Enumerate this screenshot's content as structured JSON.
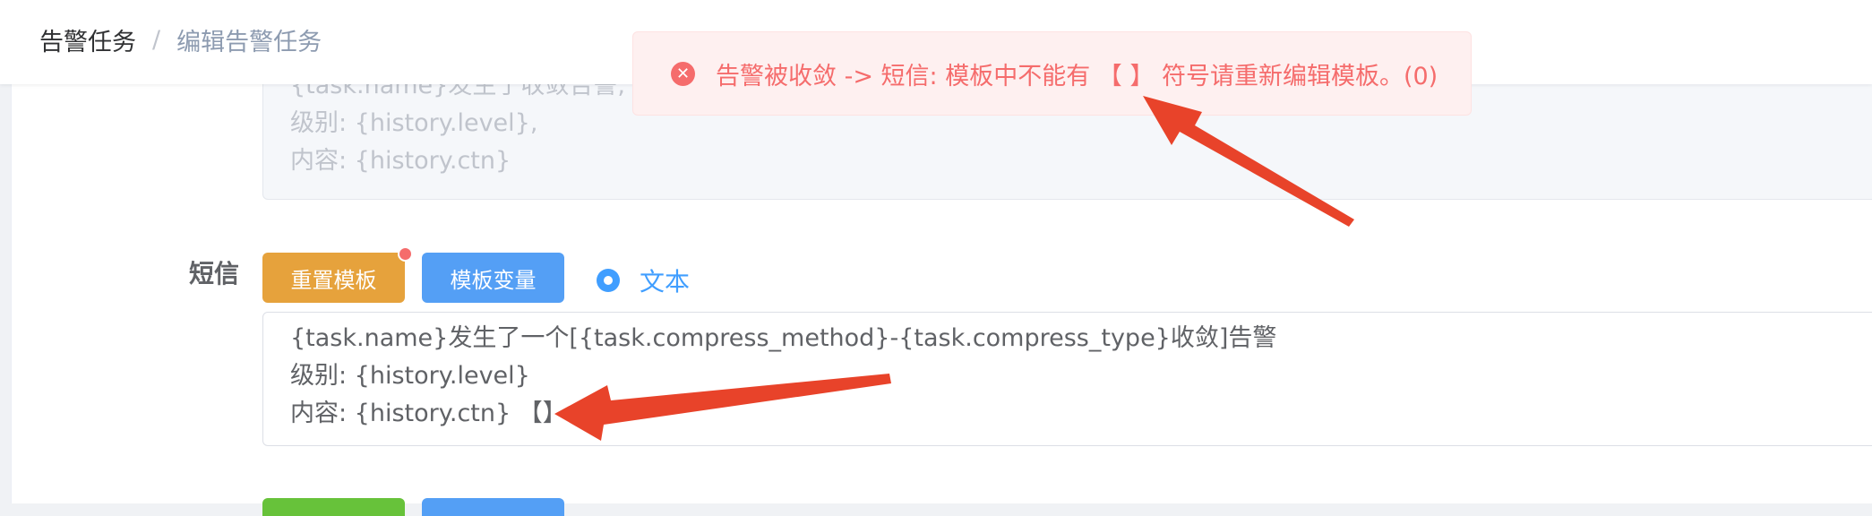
{
  "breadcrumb": {
    "items": [
      "告警任务",
      "编辑告警任务"
    ],
    "separator": "/"
  },
  "top_template": {
    "lines": [
      "{task.name}发生了收敛告警,",
      "级别: {history.level},",
      "内容: {history.ctn}"
    ]
  },
  "sms": {
    "label": "短信",
    "reset_button": "重置模板",
    "variables_button": "模板变量",
    "radio_label": "文本",
    "lines": [
      "{task.name}发生了一个[{task.compress_method}-{task.compress_type}收敛]告警",
      "级别: {history.level}",
      "内容: {history.ctn} 【】"
    ]
  },
  "message": {
    "icon": "close-circle-icon",
    "text": "告警被收敛 -> 短信: 模板中不能有 【 】 符号请重新编辑模板。(0)"
  },
  "colors": {
    "error": "#f56c6c",
    "warning": "#e6a23c",
    "primary": "#409eff",
    "success": "#67c23a",
    "arrow": "#e8432a"
  }
}
